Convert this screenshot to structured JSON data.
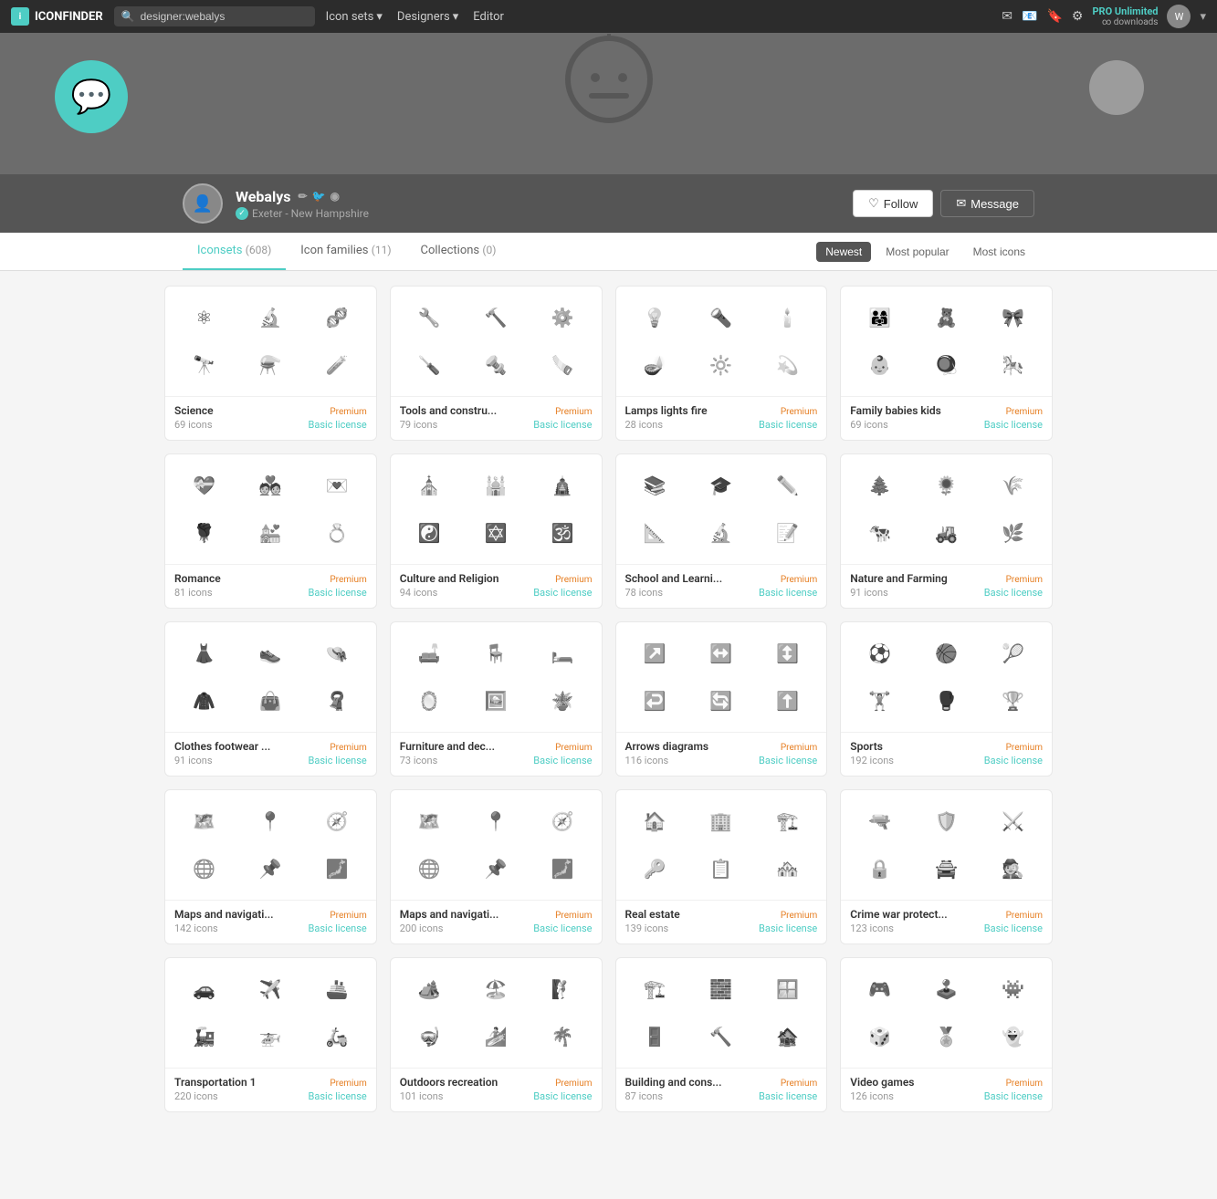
{
  "header": {
    "logo_text": "ICONFINDER",
    "search_value": "designer:webalys",
    "search_placeholder": "designer:webalys",
    "nav_items": [
      {
        "label": "Icon sets",
        "has_dropdown": true
      },
      {
        "label": "Designers",
        "has_dropdown": true
      },
      {
        "label": "Editor",
        "has_dropdown": false
      }
    ],
    "pro_label": "PRO Unlimited",
    "pro_sub": "∞ downloads"
  },
  "profile": {
    "name": "Webalys",
    "location": "Exeter - New Hampshire",
    "verified": true,
    "follow_label": "Follow",
    "message_label": "Message",
    "tabs": [
      {
        "label": "Iconsets",
        "count": "608",
        "active": true
      },
      {
        "label": "Icon families",
        "count": "11",
        "active": false
      },
      {
        "label": "Collections",
        "count": "0",
        "active": false
      }
    ],
    "filters": [
      {
        "label": "Newest",
        "active": true
      },
      {
        "label": "Most popular",
        "active": false
      },
      {
        "label": "Most icons",
        "active": false
      }
    ]
  },
  "icon_sets": [
    {
      "title": "Science",
      "icon_count": "69 icons",
      "badge": "Premium",
      "license": "Basic license",
      "icons": [
        "⚛",
        "🔬",
        "🧬",
        "🔭",
        "⚗️",
        "🧪"
      ]
    },
    {
      "title": "Tools and constru...",
      "icon_count": "79 icons",
      "badge": "Premium",
      "license": "Basic license",
      "icons": [
        "🔧",
        "🔨",
        "⚙️",
        "🪛",
        "🔩",
        "🪚"
      ]
    },
    {
      "title": "Lamps lights fire",
      "icon_count": "28 icons",
      "badge": "Premium",
      "license": "Basic license",
      "icons": [
        "💡",
        "🔦",
        "🕯️",
        "🪔",
        "🔆",
        "💫"
      ]
    },
    {
      "title": "Family babies kids",
      "icon_count": "69 icons",
      "badge": "Premium",
      "license": "Basic license",
      "icons": [
        "👨‍👩‍👧",
        "🧸",
        "🎀",
        "👶",
        "🪀",
        "🎠"
      ]
    },
    {
      "title": "Romance",
      "icon_count": "81 icons",
      "badge": "Premium",
      "license": "Basic license",
      "icons": [
        "💝",
        "💑",
        "💌",
        "🌹",
        "💒",
        "💍"
      ]
    },
    {
      "title": "Culture and Religion",
      "icon_count": "94 icons",
      "badge": "Premium",
      "license": "Basic license",
      "icons": [
        "⛪",
        "🕌",
        "🛕",
        "☯️",
        "✡️",
        "🕉️"
      ]
    },
    {
      "title": "School and Learni...",
      "icon_count": "78 icons",
      "badge": "Premium",
      "license": "Basic license",
      "icons": [
        "📚",
        "🎓",
        "✏️",
        "📐",
        "🔬",
        "📝"
      ]
    },
    {
      "title": "Nature and Farming",
      "icon_count": "91 icons",
      "badge": "Premium",
      "license": "Basic license",
      "icons": [
        "🌲",
        "🌻",
        "🌾",
        "🐄",
        "🚜",
        "🌿"
      ]
    },
    {
      "title": "Clothes footwear ...",
      "icon_count": "91 icons",
      "badge": "Premium",
      "license": "Basic license",
      "icons": [
        "👗",
        "👟",
        "👒",
        "🧥",
        "👜",
        "🧣"
      ]
    },
    {
      "title": "Furniture and dec...",
      "icon_count": "73 icons",
      "badge": "Premium",
      "license": "Basic license",
      "icons": [
        "🛋️",
        "🪑",
        "🛏️",
        "🪞",
        "🖼️",
        "🪴"
      ]
    },
    {
      "title": "Arrows diagrams",
      "icon_count": "116 icons",
      "badge": "Premium",
      "license": "Basic license",
      "icons": [
        "↗️",
        "↔️",
        "↕️",
        "↩️",
        "🔄",
        "⬆️"
      ]
    },
    {
      "title": "Sports",
      "icon_count": "192 icons",
      "badge": "Premium",
      "license": "Basic license",
      "icons": [
        "⚽",
        "🏀",
        "🎾",
        "🏋️",
        "🥊",
        "🏆"
      ]
    },
    {
      "title": "Maps and navigati...",
      "icon_count": "142 icons",
      "badge": "Premium",
      "license": "Basic license",
      "icons": [
        "🗺️",
        "📍",
        "🧭",
        "🌐",
        "📌",
        "🗾"
      ]
    },
    {
      "title": "Maps and navigati...",
      "icon_count": "200 icons",
      "badge": "Premium",
      "license": "Basic license",
      "icons": [
        "🗺️",
        "📍",
        "🧭",
        "🌐",
        "📌",
        "🗾"
      ]
    },
    {
      "title": "Real estate",
      "icon_count": "139 icons",
      "badge": "Premium",
      "license": "Basic license",
      "icons": [
        "🏠",
        "🏢",
        "🏗️",
        "🔑",
        "📋",
        "🏘️"
      ]
    },
    {
      "title": "Crime war protect...",
      "icon_count": "123 icons",
      "badge": "Premium",
      "license": "Basic license",
      "icons": [
        "🔫",
        "🛡️",
        "⚔️",
        "🔒",
        "🚔",
        "🕵️"
      ]
    },
    {
      "title": "Transportation 1",
      "icon_count": "220 icons",
      "badge": "Premium",
      "license": "Basic license",
      "icons": [
        "🚗",
        "✈️",
        "🚢",
        "🚂",
        "🚁",
        "🛵"
      ]
    },
    {
      "title": "Outdoors recreation",
      "icon_count": "101 icons",
      "badge": "Premium",
      "license": "Basic license",
      "icons": [
        "🏕️",
        "🏖️",
        "🧗",
        "🤿",
        "🏄",
        "🌴"
      ]
    },
    {
      "title": "Building and cons...",
      "icon_count": "87 icons",
      "badge": "Premium",
      "license": "Basic license",
      "icons": [
        "🏗️",
        "🧱",
        "🪟",
        "🚪",
        "🔨",
        "🏚️"
      ]
    },
    {
      "title": "Video games",
      "icon_count": "126 icons",
      "badge": "Premium",
      "license": "Basic license",
      "icons": [
        "🎮",
        "🕹️",
        "👾",
        "🎲",
        "🏅",
        "👻"
      ]
    }
  ]
}
